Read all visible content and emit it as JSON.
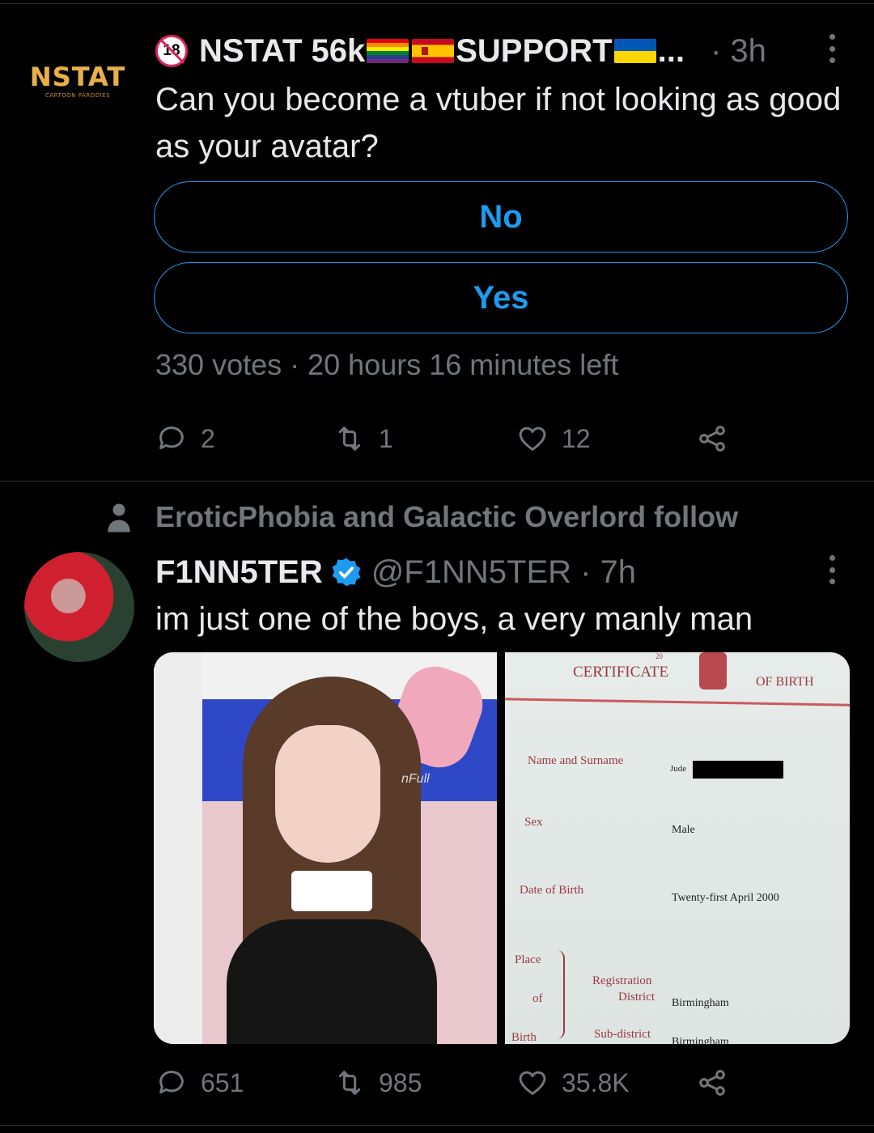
{
  "tweet1": {
    "avatar_text": "NSTAT",
    "avatar_subtext": "CARTOON PARODIES",
    "age_badge": "18",
    "name_part1": "NSTAT 56k",
    "name_part2": "SUPPORT",
    "ellipsis": "...",
    "time": "· 3h",
    "text": "Can you become a vtuber if not looking as good as your avatar?",
    "poll_options": [
      "No",
      "Yes"
    ],
    "poll_meta": "330 votes · 20 hours 16 minutes left",
    "replies": "2",
    "retweets": "1",
    "likes": "12"
  },
  "tweet2": {
    "follow_context": "EroticPhobia and Galactic Overlord follow",
    "name": "F1NN5TER",
    "handle_time": "@F1NN5TER · 7h",
    "text": "im just one of the boys, a very manly man",
    "media_left_chair_text": "nFull",
    "certificate": {
      "header_small": "20",
      "title_left": "CERTIFICATE",
      "title_right": "OF BIRTH",
      "name_label": "Name and Surname",
      "name_value": "Jude",
      "sex_label": "Sex",
      "sex_value": "Male",
      "dob_label": "Date of Birth",
      "dob_value": "Twenty-first April 2000",
      "place_label_1": "Place",
      "place_label_2": "of",
      "place_label_3": "Birth",
      "reg_district_label_1": "Registration",
      "reg_district_label_2": "District",
      "reg_district_value": "Birmingham",
      "subdistrict_label": "Sub-district",
      "subdistrict_value": "Birmingham"
    },
    "replies": "651",
    "retweets": "985",
    "likes": "35.8K"
  },
  "colors": {
    "accent": "#1d9bf0",
    "muted": "#71767b",
    "background": "#000000"
  }
}
